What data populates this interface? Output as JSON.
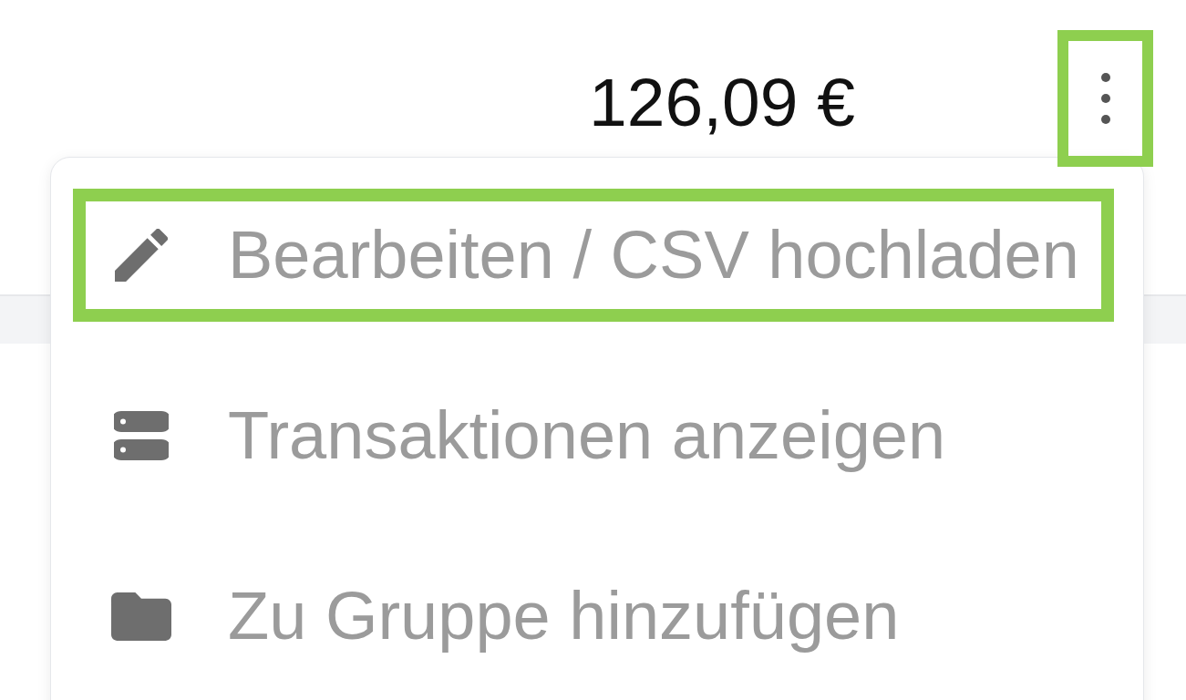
{
  "amount": "126,09 €",
  "menu_button": {
    "highlighted": true
  },
  "menu": {
    "items": [
      {
        "label": "Bearbeiten / CSV hochladen",
        "highlighted": true
      },
      {
        "label": "Transaktionen anzeigen",
        "highlighted": false
      },
      {
        "label": "Zu Gruppe hinzufügen",
        "highlighted": false
      }
    ]
  }
}
